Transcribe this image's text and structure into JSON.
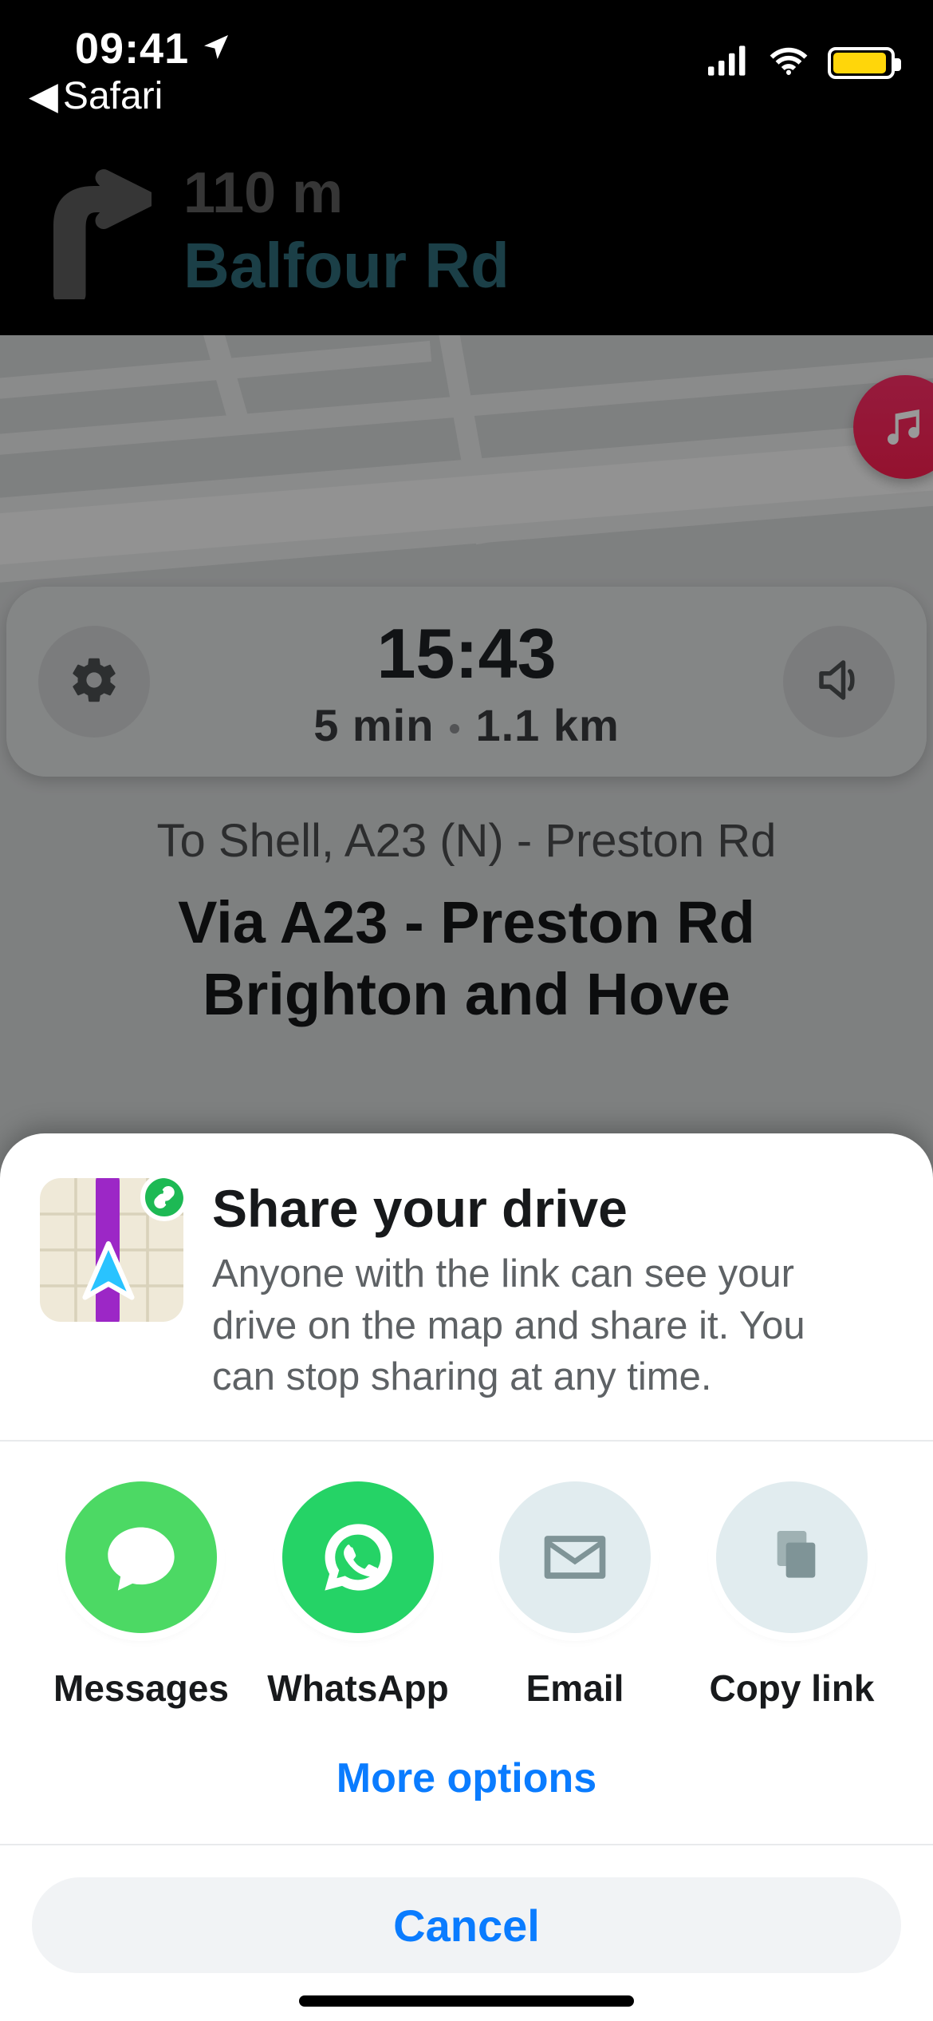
{
  "status": {
    "time": "09:41",
    "back_app": "Safari"
  },
  "nav": {
    "distance": "110 m",
    "street": "Balfour Rd"
  },
  "eta": {
    "arrival": "15:43",
    "duration": "5 min",
    "distance": "1.1 km"
  },
  "destination": {
    "to": "To Shell, A23 (N) - Preston Rd",
    "via_line1": "Via A23 - Preston Rd",
    "via_line2": "Brighton and Hove"
  },
  "sheet": {
    "title": "Share your drive",
    "description": "Anyone with the link can see your drive on the map and share it. You can stop sharing at any time.",
    "more": "More options",
    "cancel": "Cancel",
    "options": {
      "messages": "Messages",
      "whatsapp": "WhatsApp",
      "email": "Email",
      "copylink": "Copy link"
    }
  },
  "colors": {
    "accent": "#0a7cff",
    "battery": "#ffd60a",
    "music": "#f71e4f",
    "whatsapp": "#25d366",
    "messages": "#4cd964"
  }
}
